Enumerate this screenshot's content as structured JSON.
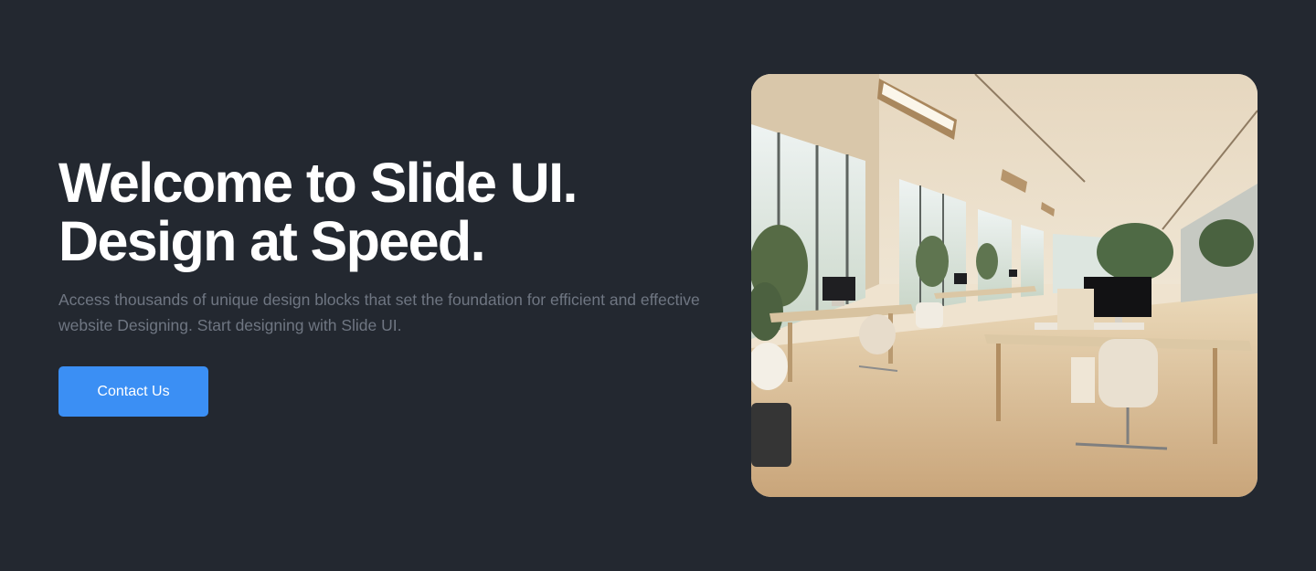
{
  "hero": {
    "headline_line1": "Welcome to Slide UI.",
    "headline_line2": "Design at Speed.",
    "description": "Access thousands of unique design blocks that set the foundation for efficient and effective website Designing. Start designing with Slide UI.",
    "cta_label": "Contact Us"
  },
  "colors": {
    "background": "#232830",
    "heading": "#ffffff",
    "body_text": "#6f7682",
    "accent": "#3b8ff4"
  }
}
